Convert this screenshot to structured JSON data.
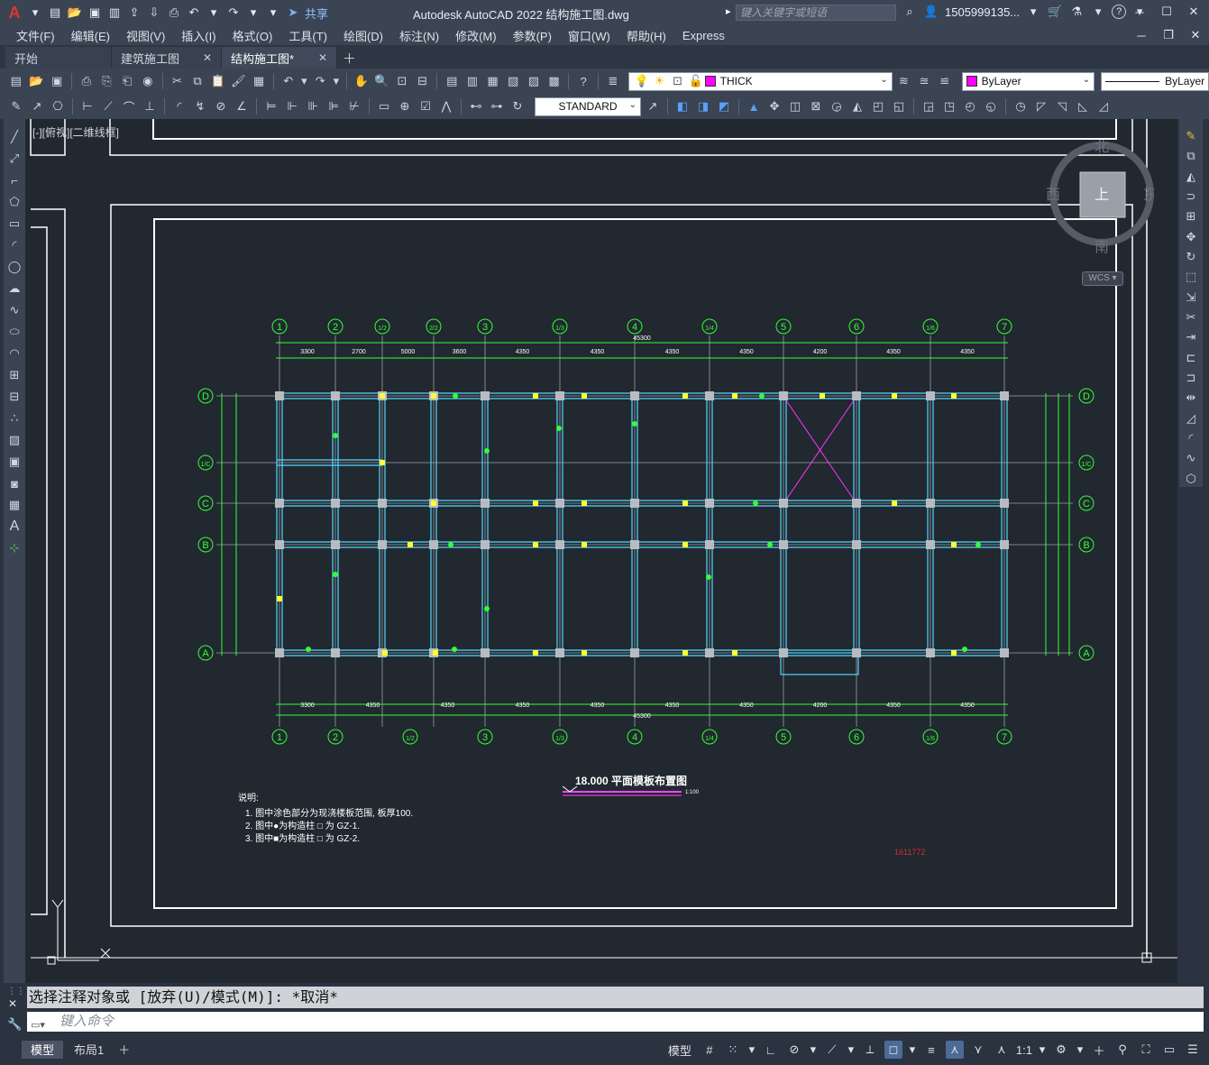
{
  "titlebar": {
    "app_title": "Autodesk AutoCAD 2022    结构施工图.dwg",
    "share_label": "共享",
    "search_placeholder": "键入关键字或短语",
    "user": "1505999135...",
    "help": "?"
  },
  "menu": [
    "文件(F)",
    "编辑(E)",
    "视图(V)",
    "插入(I)",
    "格式(O)",
    "工具(T)",
    "绘图(D)",
    "标注(N)",
    "修改(M)",
    "参数(P)",
    "窗口(W)",
    "帮助(H)",
    "Express"
  ],
  "tabs": [
    {
      "label": "开始",
      "closable": false,
      "active": false
    },
    {
      "label": "建筑施工图",
      "closable": true,
      "active": false
    },
    {
      "label": "结构施工图*",
      "closable": true,
      "active": true
    }
  ],
  "toolbar": {
    "layer": "THICK",
    "color": "ByLayer",
    "linetype": "ByLayer",
    "dimstyle": "STANDARD",
    "layer_color": "#ff00ff"
  },
  "viewport": {
    "label": "[-][俯视][二维线框]",
    "viewcube": {
      "north": "北",
      "south": "南",
      "east": "东",
      "west": "西",
      "top": "上",
      "wcs": "WCS"
    }
  },
  "drawing": {
    "axes_top": [
      "1",
      "2",
      "1/2",
      "2/2",
      "3",
      "1/3",
      "4",
      "1/4",
      "5",
      "6",
      "1/6",
      "7"
    ],
    "axes_bottom": [
      "1",
      "2",
      "1/2",
      "3",
      "1/3",
      "4",
      "1/4",
      "5",
      "6",
      "1/6",
      "7"
    ],
    "axes_side": [
      "D",
      "1/C",
      "C",
      "B",
      "A"
    ],
    "dims_top": [
      "3300",
      "2700",
      "5000",
      "3600",
      "4350",
      "4350",
      "4350",
      "4350",
      "4200",
      "4350",
      "4350"
    ],
    "dims_bottom": [
      "3300",
      "4350",
      "4350",
      "4350",
      "4350",
      "4350",
      "4350",
      "4200",
      "4350",
      "4350"
    ],
    "total_dim": "45300",
    "title": "18.000  平面模板布置图",
    "scale": "1:100",
    "code": "1611772",
    "notes_title": "说明:",
    "notes": [
      "1. 图中涂色部分为现浇楼板范围, 板厚100.",
      "2. 图中●为构造柱 □ 为 GZ-1.",
      "3. 图中■为构造柱 □ 为 GZ-2."
    ]
  },
  "command": {
    "history": "选择注释对象或 [放弃(U)/模式(M)]: *取消*",
    "placeholder": "键入命令"
  },
  "status": {
    "layouts": [
      "模型",
      "布局1"
    ],
    "model_label": "模型",
    "scale": "1:1"
  }
}
